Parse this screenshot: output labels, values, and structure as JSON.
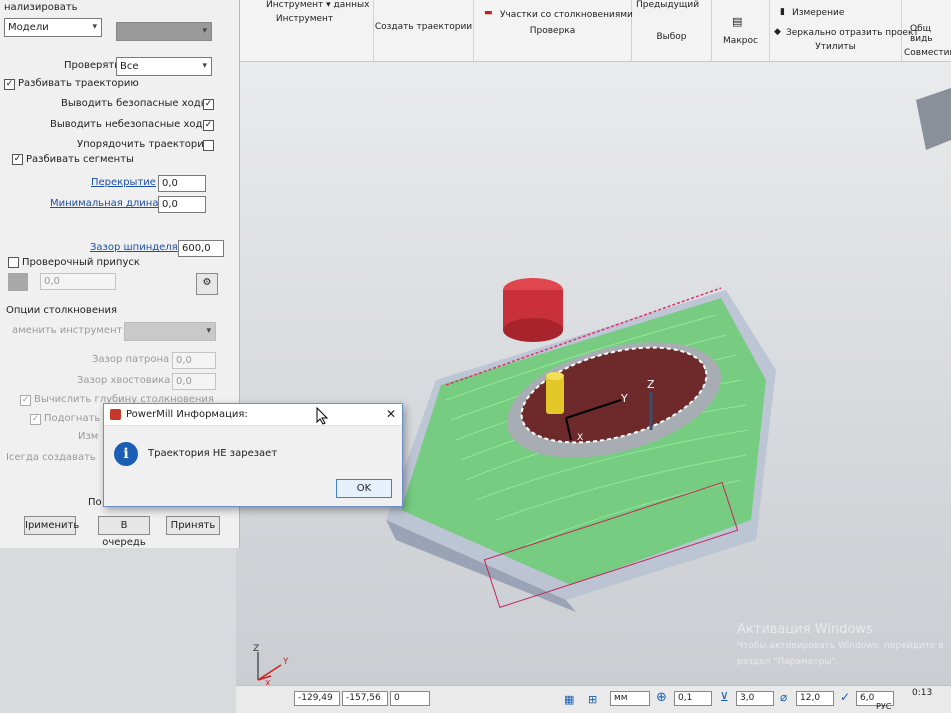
{
  "ribbon": {
    "tool_top": "Инструмент ▾ данных",
    "tool_group": "Инструмент",
    "create_paths": "Создать траектории",
    "collisions_item": "Участки со столкновениями",
    "check_group": "Проверка",
    "previous": "Предыдущий",
    "select_group": "Выбор",
    "macro_group": "Макрос",
    "measure": "Измерение",
    "mirror": "Зеркально отразить проект",
    "utilities_group": "Утилиты",
    "shared": "Общ видь",
    "compat": "Совместим"
  },
  "panel": {
    "header": "нализировать",
    "models_select": "Модели",
    "check_label": "Проверять",
    "check_value": "Все",
    "split_path": "Разбивать траекторию",
    "output_safe": "Выводить безопасные ходы",
    "output_unsafe": "Выводить небезопасные ходы",
    "order_paths": "Упорядочить траектории",
    "split_segments": "Разбивать сегменты",
    "overlap_label": "Перекрытие",
    "overlap_value": "0,0",
    "minlen_label": "Минимальная длина",
    "minlen_value": "0,0",
    "spindle_label": "Зазор шпинделя",
    "spindle_value": "600,0",
    "check_allowance": "Проверочный припуск",
    "allowance_value": "0,0",
    "collision_options": "Опции столкновения",
    "replace_tool": "аменить инструмент",
    "holder_gap_label": "Зазор патрона",
    "holder_gap_value": "0,0",
    "shank_gap_label": "Зазор хвостовика",
    "shank_gap_value": "0,0",
    "calc_depth": "Вычислить глубину столкновения",
    "fit": "Подогнать",
    "izm": "Изм",
    "always_create": "Iсегда создавать",
    "po": "По",
    "apply_btn": "Iрименить",
    "queue_btn": "В очередь",
    "accept_btn": "Принять"
  },
  "dialog": {
    "title": "PowerMill Информация:",
    "message": "Траектория НЕ зарезает",
    "ok": "OK",
    "close": "✕",
    "info_icon": "i"
  },
  "viewport": {
    "axis_y": "Y",
    "axis_z": "Z",
    "axis_x": "X",
    "tri_z": "Z",
    "tri_y": "Y",
    "tri_x": "X"
  },
  "status": {
    "coord1": "-129,49",
    "coord2": "-157,56",
    "coord3": "0",
    "unit": "мм",
    "tol": "0,1",
    "thick": "3,0",
    "dia": "12,0",
    "step": "6,0",
    "time": "0:13",
    "lang": "РУС"
  },
  "watermark": {
    "line1": "Активация Windows",
    "line2": "Чтобы активировать Windows, перейдите в",
    "line3": "раздел \"Параметры\"."
  },
  "colors": {
    "toolpath": "#3cd23c",
    "stock": "#b9c2d4",
    "pocket": "#6e2a2a",
    "holder": "#c9303a",
    "tool": "#e3c82a",
    "accent": "#1a5fb4"
  }
}
